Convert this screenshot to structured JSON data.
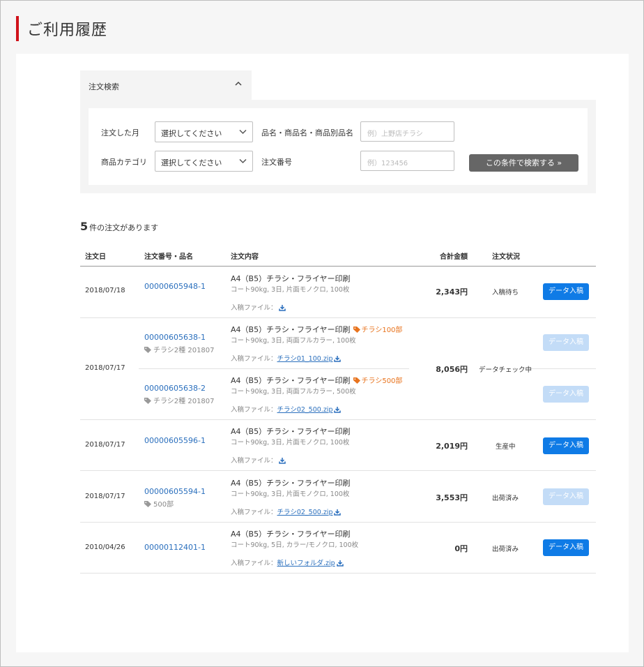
{
  "page": {
    "title": "ご利用履歴"
  },
  "search": {
    "tab_label": "注文検索",
    "month_label": "注文した月",
    "month_value": "選択してください",
    "name_label": "品名・商品名・商品別品名",
    "name_placeholder": "例）上野店チラシ",
    "category_label": "商品カテゴリ",
    "category_value": "選択してください",
    "order_no_label": "注文番号",
    "order_no_placeholder": "例）123456",
    "submit_label": "この条件で検索する »"
  },
  "results": {
    "count": "5",
    "count_suffix": "件の注文があります"
  },
  "table": {
    "headers": {
      "date": "注文日",
      "order": "注文番号・品名",
      "content": "注文内容",
      "total": "合計金額",
      "status": "注文状況"
    },
    "file_label": "入稿ファイル：",
    "button_label": "データ入稿",
    "rows": [
      {
        "date": "2018/07/18",
        "total": "2,343円",
        "status": "入稿待ち",
        "items": [
          {
            "order_no": "00000605948-1",
            "tag": "",
            "product": "A4（B5）チラシ・フライヤー印刷",
            "promo": "",
            "spec": "コート90kg, 3日, 片面モノクロ, 100枚",
            "file": ""
          }
        ]
      },
      {
        "date": "2018/07/17",
        "total": "8,056円",
        "status": "データチェック中",
        "items": [
          {
            "order_no": "00000605638-1",
            "tag": "チラシ2種 201807",
            "product": "A4（B5）チラシ・フライヤー印刷",
            "promo": "チラシ100部",
            "spec": "コート90kg, 3日, 両面フルカラー, 100枚",
            "file": "チラシ01_100.zip"
          },
          {
            "order_no": "00000605638-2",
            "tag": "チラシ2種 201807",
            "product": "A4（B5）チラシ・フライヤー印刷",
            "promo": "チラシ500部",
            "spec": "コート90kg, 3日, 両面フルカラー, 500枚",
            "file": "チラシ02_500.zip"
          }
        ]
      },
      {
        "date": "2018/07/17",
        "total": "2,019円",
        "status": "生産中",
        "items": [
          {
            "order_no": "00000605596-1",
            "tag": "",
            "product": "A4（B5）チラシ・フライヤー印刷",
            "promo": "",
            "spec": "コート90kg, 3日, 片面モノクロ, 100枚",
            "file": ""
          }
        ]
      },
      {
        "date": "2018/07/17",
        "total": "3,553円",
        "status": "出荷済み",
        "items": [
          {
            "order_no": "00000605594-1",
            "tag": "500部",
            "product": "A4（B5）チラシ・フライヤー印刷",
            "promo": "",
            "spec": "コート90kg, 3日, 片面モノクロ, 100枚",
            "file": "チラシ02_500.zip"
          }
        ]
      },
      {
        "date": "2010/04/26",
        "total": "0円",
        "status": "出荷済み",
        "items": [
          {
            "order_no": "00000112401-1",
            "tag": "",
            "product": "A4（B5）チラシ・フライヤー印刷",
            "promo": "",
            "spec": "コート90kg, 5日, カラー/モノクロ, 100枚",
            "file": "新しいフォルダ.zip"
          }
        ]
      }
    ]
  },
  "colors": {
    "accent": "#d0121b",
    "link": "#2a6fbd",
    "primary_button": "#0f7be6",
    "disabled_button": "#c3dcf7",
    "promo": "#e8731d"
  },
  "icons": [
    "chevron-up-icon",
    "chevron-down-icon",
    "tag-icon",
    "download-icon"
  ]
}
